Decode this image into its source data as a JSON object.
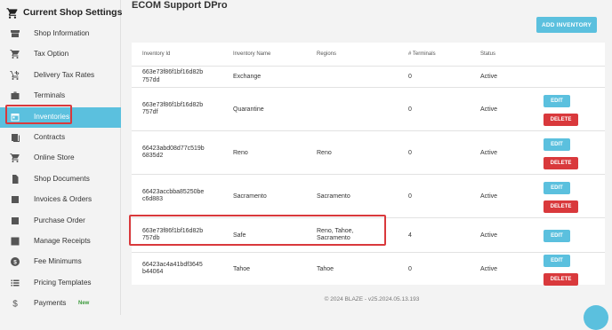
{
  "sidebar": {
    "header": "Current Shop Settings",
    "items": [
      {
        "label": "Shop Information",
        "icon": "store-icon"
      },
      {
        "label": "Tax Option",
        "icon": "cart-icon"
      },
      {
        "label": "Delivery Tax Rates",
        "icon": "cart-plus-icon"
      },
      {
        "label": "Terminals",
        "icon": "briefcase-icon"
      },
      {
        "label": "Inventories",
        "icon": "calendar-icon",
        "active": true
      },
      {
        "label": "Contracts",
        "icon": "contracts-icon"
      },
      {
        "label": "Online Store",
        "icon": "cart-icon"
      },
      {
        "label": "Shop Documents",
        "icon": "document-icon"
      },
      {
        "label": "Invoices & Orders",
        "icon": "list-icon"
      },
      {
        "label": "Purchase Order",
        "icon": "list-icon"
      },
      {
        "label": "Manage Receipts",
        "icon": "image-icon"
      },
      {
        "label": "Fee Minimums",
        "icon": "dollar-circle-icon"
      },
      {
        "label": "Pricing Templates",
        "icon": "list-bullets-icon"
      },
      {
        "label": "Payments",
        "icon": "dollar-icon",
        "badge": "New"
      }
    ]
  },
  "main": {
    "title": "ECOM Support DPro",
    "add_button": "ADD INVENTORY",
    "columns": [
      "Inventory Id",
      "Inventory Name",
      "Regions",
      "# Terminals",
      "Status"
    ],
    "rows": [
      {
        "id": "663e73f86f1bf16d82b757dd",
        "name": "Exchange",
        "regions": "",
        "terminals": "0",
        "status": "Active",
        "edit": false,
        "delete": false
      },
      {
        "id": "663e73f86f1bf16d82b757df",
        "name": "Quarantine",
        "regions": "",
        "terminals": "0",
        "status": "Active",
        "edit": true,
        "delete": true
      },
      {
        "id": "66423abd08d77c519b6835d2",
        "name": "Reno",
        "regions": "Reno",
        "terminals": "0",
        "status": "Active",
        "edit": true,
        "delete": true
      },
      {
        "id": "66423accbba85250bec6d883",
        "name": "Sacramento",
        "regions": "Sacramento",
        "terminals": "0",
        "status": "Active",
        "edit": true,
        "delete": true
      },
      {
        "id": "663e73f86f1bf16d82b757db",
        "name": "Safe",
        "regions": "Reno, Tahoe, Sacramento",
        "terminals": "4",
        "status": "Active",
        "edit": true,
        "delete": false
      },
      {
        "id": "66423ac4a41bdf3645b44064",
        "name": "Tahoe",
        "regions": "Tahoe",
        "terminals": "0",
        "status": "Active",
        "edit": true,
        "delete": true
      }
    ],
    "edit_label": "EDIT",
    "delete_label": "DELETE",
    "footer": "© 2024 BLAZE - v25.2024.05.13.193"
  },
  "colors": {
    "accent": "#5bc0de",
    "danger": "#d9393c",
    "badge_new": "#3c9a3c"
  }
}
